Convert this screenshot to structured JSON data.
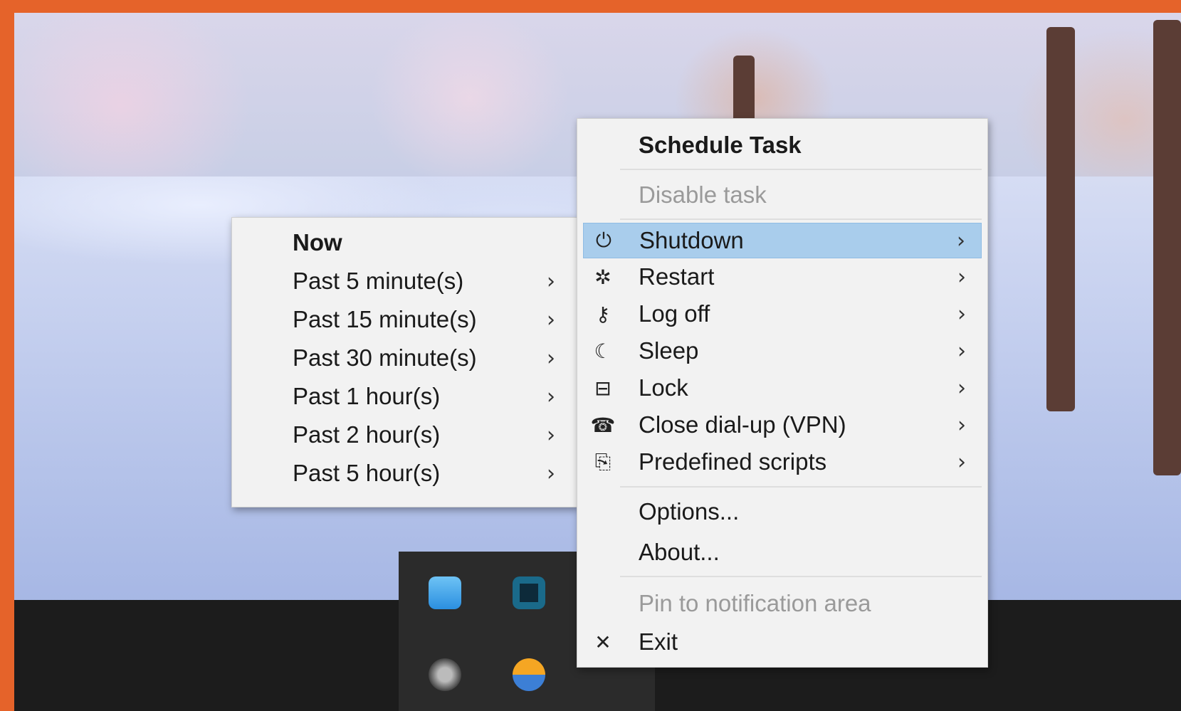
{
  "main_menu": {
    "title": "Schedule Task",
    "disable_task": "Disable task",
    "items": [
      {
        "label": "Shutdown",
        "icon": "power-icon",
        "glyph": "⏻"
      },
      {
        "label": "Restart",
        "icon": "restart-icon",
        "glyph": "✲"
      },
      {
        "label": "Log off",
        "icon": "key-icon",
        "glyph": "⚷"
      },
      {
        "label": "Sleep",
        "icon": "moon-icon",
        "glyph": "☾"
      },
      {
        "label": "Lock",
        "icon": "lock-icon",
        "glyph": "⊟"
      },
      {
        "label": "Close dial-up (VPN)",
        "icon": "phone-icon",
        "glyph": "☎"
      },
      {
        "label": "Predefined scripts",
        "icon": "script-icon",
        "glyph": "⎘"
      }
    ],
    "options": "Options...",
    "about": "About...",
    "pin": "Pin to notification area",
    "exit": "Exit",
    "exit_glyph": "✕",
    "arrow": "›"
  },
  "sub_menu": {
    "now": "Now",
    "items": [
      "Past 5 minute(s)",
      "Past 15 minute(s)",
      "Past 30 minute(s)",
      "Past 1 hour(s)",
      "Past 2 hour(s)",
      "Past 5 hour(s)"
    ]
  },
  "tray": {
    "icons": [
      "cloud-icon",
      "network-icon",
      "satellite-icon",
      "landscape-icon"
    ]
  },
  "colors": {
    "highlight": "#a9cdec",
    "menu_bg": "#f2f2f2",
    "frame": "#e5632a"
  }
}
